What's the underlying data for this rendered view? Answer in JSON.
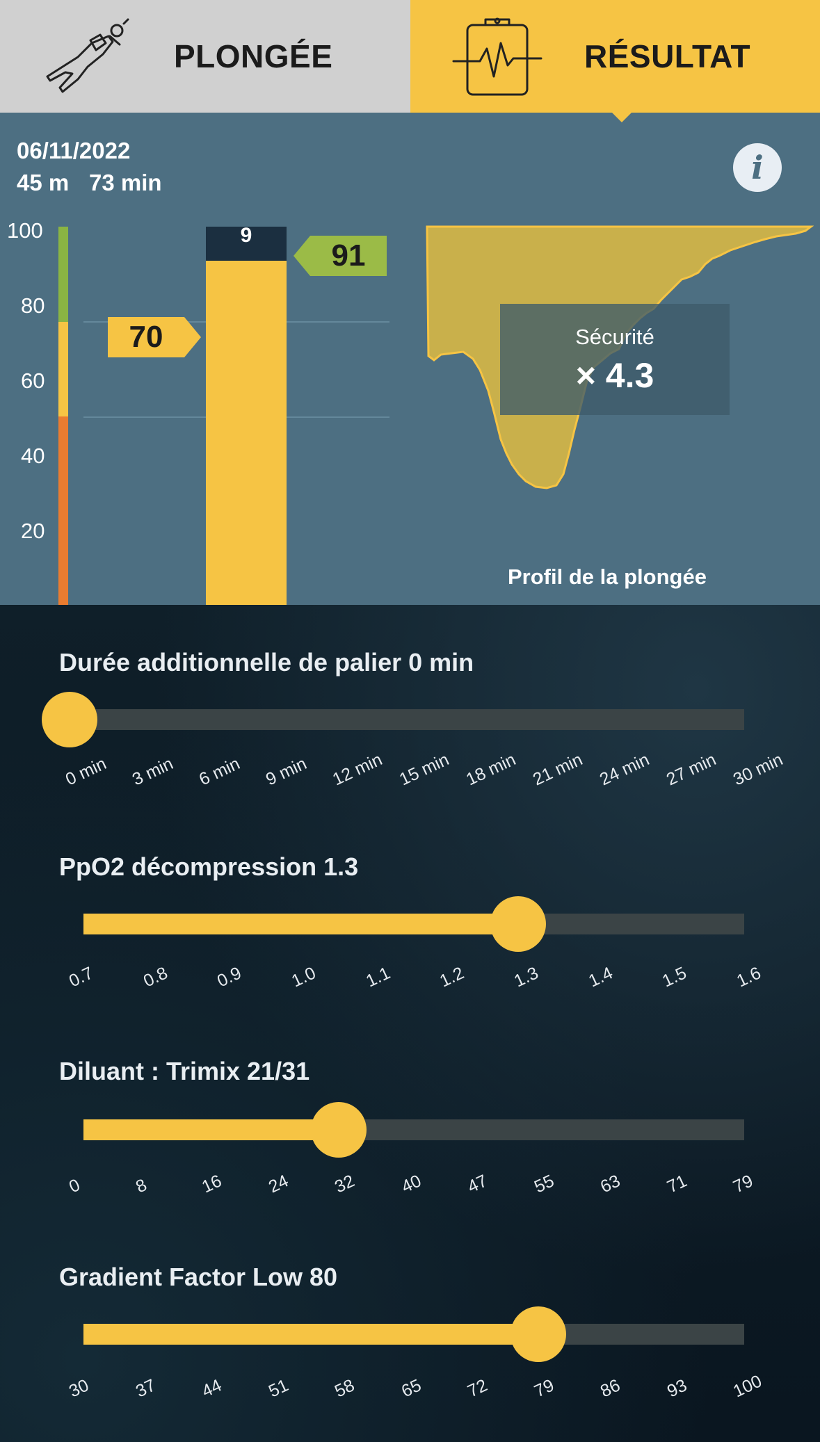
{
  "tabs": {
    "dive_label": "PLONGÉE",
    "result_label": "RÉSULTAT",
    "active": "result",
    "dive_icon": "diver-icon",
    "result_icon": "clipboard-ecg-icon"
  },
  "summary": {
    "date": "06/11/2022",
    "depth": "45 m",
    "duration": "73 min",
    "info_icon": "i"
  },
  "score_chart": {
    "y_ticks": [
      "100",
      "80",
      "60",
      "40",
      "20"
    ],
    "score": 91,
    "score_label": "91",
    "remainder_label": "9",
    "reference": 70,
    "reference_label": "70",
    "scale_colors": {
      "green": "#8ab443",
      "yellow": "#f6c444",
      "orange": "#e97c30"
    },
    "scale_segments": [
      {
        "color": "green",
        "from": 75,
        "to": 100
      },
      {
        "color": "yellow",
        "from": 50,
        "to": 75
      },
      {
        "color": "orange",
        "from": 0,
        "to": 50
      }
    ]
  },
  "profile": {
    "title": "Profil de la plongée",
    "safety_label": "Sécurité",
    "safety_value": "× 4.3"
  },
  "controls": {
    "palier": {
      "title": "Durée additionnelle de palier 0 min",
      "value_index": 0,
      "ticks": [
        "0 min",
        "3 min",
        "6 min",
        "9 min",
        "12 min",
        "15 min",
        "18 min",
        "21 min",
        "24 min",
        "27 min",
        "30 min"
      ]
    },
    "ppo2": {
      "title": "PpO2 décompression 1.3",
      "value_index": 6,
      "ticks": [
        "0.7",
        "0.8",
        "0.9",
        "1.0",
        "1.1",
        "1.2",
        "1.3",
        "1.4",
        "1.5",
        "1.6"
      ]
    },
    "diluant": {
      "title": "Diluant : Trimix 21/31",
      "value_index": 4,
      "ticks": [
        "0",
        "8",
        "16",
        "24",
        "32",
        "40",
        "47",
        "55",
        "63",
        "71",
        "79"
      ]
    },
    "gf_low": {
      "title": "Gradient Factor Low  80",
      "value_index": 7,
      "ticks": [
        "30",
        "37",
        "44",
        "51",
        "58",
        "65",
        "72",
        "79",
        "86",
        "93",
        "100"
      ]
    }
  },
  "colors": {
    "accent": "#f6c444",
    "panel": "#4d6f82",
    "dark": "#0d1b24"
  }
}
